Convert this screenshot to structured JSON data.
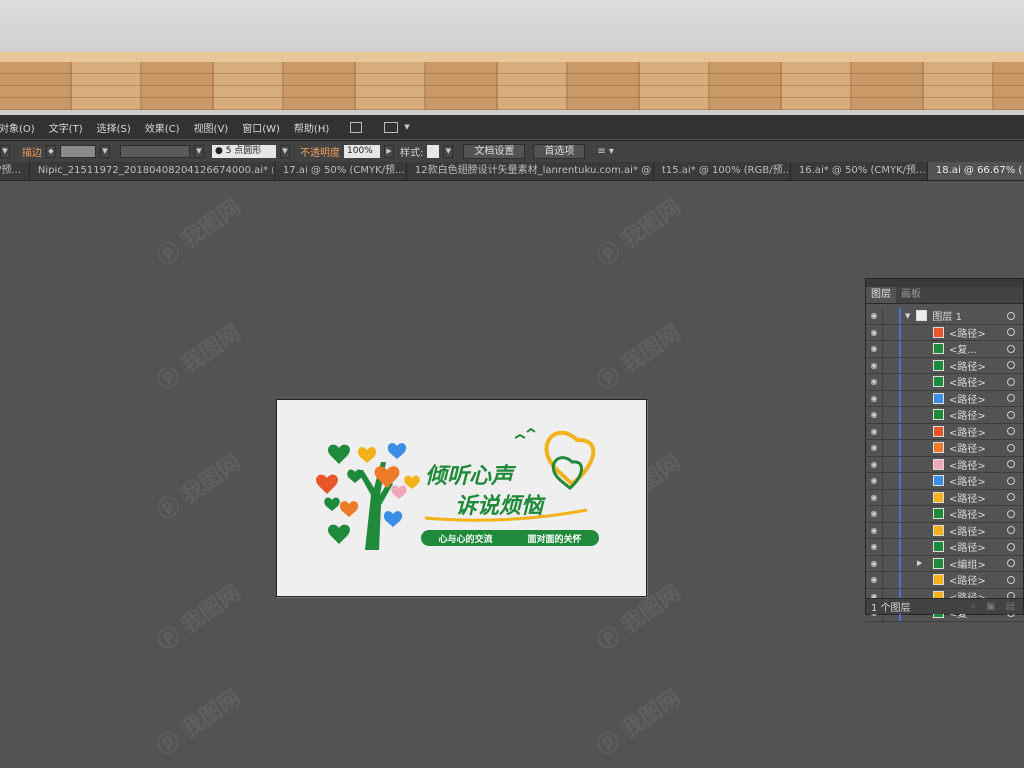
{
  "menubar": {
    "items": [
      "对象(O)",
      "文字(T)",
      "选择(S)",
      "效果(C)",
      "视图(V)",
      "窗口(W)",
      "帮助(H)"
    ]
  },
  "control_bar": {
    "stroke_label": "描边",
    "brush_value": "5 点圆形",
    "opacity_label": "不透明度",
    "opacity_value": "100%",
    "style_label": "样式:",
    "doc_setup_button": "文档设置",
    "preferences_button": "首选项"
  },
  "tabs": [
    {
      "label": "/预...",
      "active": false
    },
    {
      "label": "Nipic_21511972_20180408204126674000.ai* @ 19...",
      "active": false
    },
    {
      "label": "17.ai @ 50% (CMYK/预...",
      "active": false
    },
    {
      "label": "12款白色翅膀设计矢量素材_lanrentuku.com.ai* @ 7...",
      "active": false
    },
    {
      "label": "t15.ai* @ 100% (RGB/预...",
      "active": false
    },
    {
      "label": "16.ai* @ 50% (CMYK/预...",
      "active": false
    },
    {
      "label": "18.ai @ 66.67% (",
      "active": true
    }
  ],
  "artwork": {
    "title_line1": "倾听心声",
    "title_line2": "诉说烦恼",
    "banner_left": "心与心的交流",
    "banner_right": "面对面的关怀"
  },
  "layers_panel": {
    "tabs": [
      "图层",
      "画板"
    ],
    "layer_name": "图层 1",
    "rows": [
      {
        "label": "<路径>",
        "color": "#e8562a"
      },
      {
        "label": "<复...",
        "color": "#1f8a3a"
      },
      {
        "label": "<路径>",
        "color": "#1f8a3a"
      },
      {
        "label": "<路径>",
        "color": "#1f8a3a"
      },
      {
        "label": "<路径>",
        "color": "#3a8ee6"
      },
      {
        "label": "<路径>",
        "color": "#1f8a3a"
      },
      {
        "label": "<路径>",
        "color": "#e8562a"
      },
      {
        "label": "<路径>",
        "color": "#ef7a2a"
      },
      {
        "label": "<路径>",
        "color": "#f2a7b8"
      },
      {
        "label": "<路径>",
        "color": "#3a8ee6"
      },
      {
        "label": "<路径>",
        "color": "#f3b21b"
      },
      {
        "label": "<路径>",
        "color": "#1f8a3a"
      },
      {
        "label": "<路径>",
        "color": "#f3b21b"
      },
      {
        "label": "<路径>",
        "color": "#1f8a3a"
      },
      {
        "label": "<编组>",
        "color": "#1f8a3a"
      },
      {
        "label": "<路径>",
        "color": "#f3b21b"
      },
      {
        "label": "<路径>",
        "color": "#f3b21b"
      },
      {
        "label": "<复",
        "color": "#1f8a3a"
      }
    ],
    "footer": "1 个图层"
  },
  "colors": {
    "green": "#1f8a3a",
    "orange": "#ef7a2a",
    "yellow": "#f3b21b",
    "blue": "#3a8ee6"
  }
}
